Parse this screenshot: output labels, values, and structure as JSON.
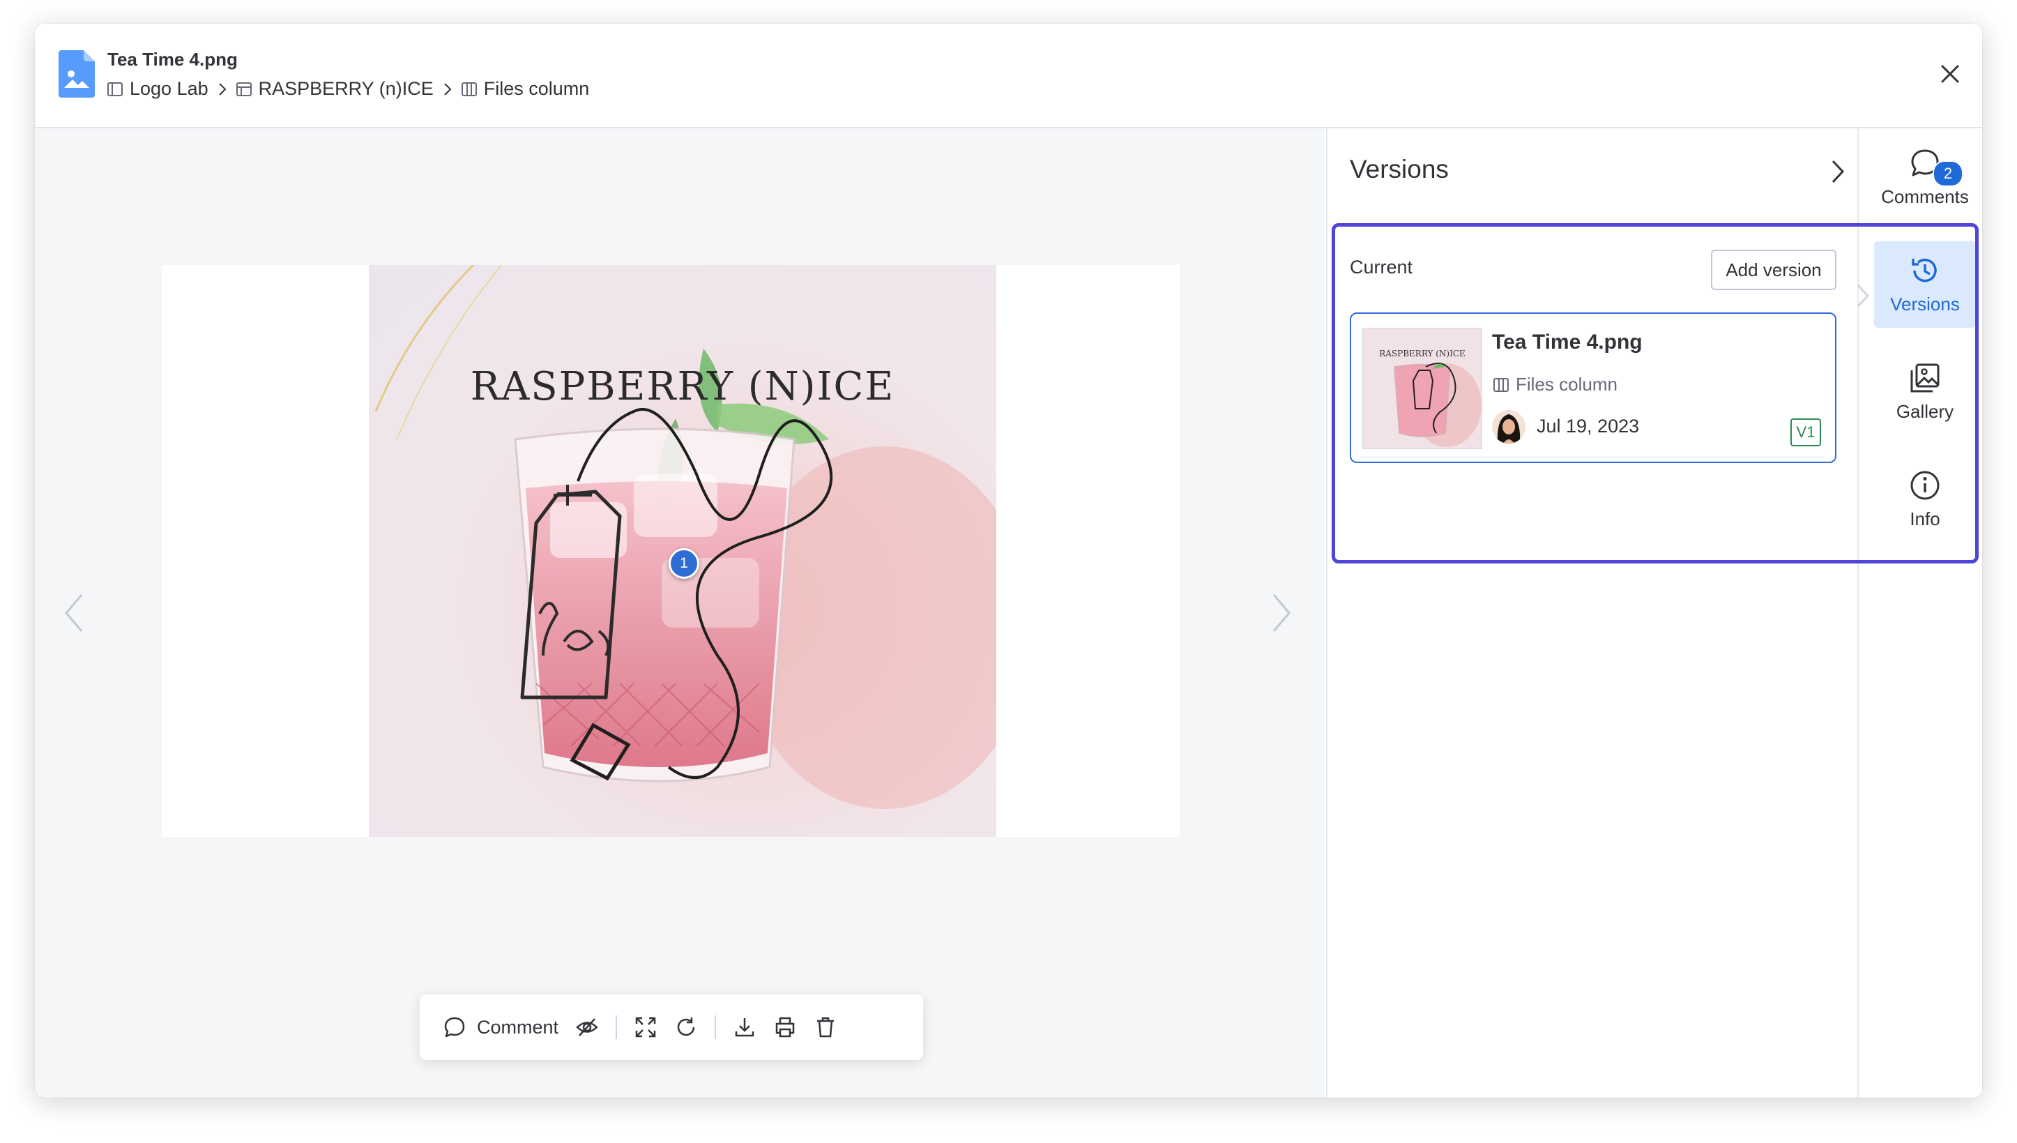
{
  "header": {
    "file_title": "Tea Time 4.png",
    "breadcrumb": [
      "Logo Lab",
      "RASPBERRY (n)ICE",
      "Files column"
    ]
  },
  "preview": {
    "image_title_text": "RASPBERRY (N)ICE",
    "pin_number": "1"
  },
  "toolbar": {
    "comment_label": "Comment"
  },
  "versions": {
    "title": "Versions",
    "current_label": "Current",
    "add_version_label": "Add version",
    "card": {
      "name": "Tea Time 4.png",
      "column": "Files column",
      "date": "Jul 19, 2023",
      "badge": "V1"
    }
  },
  "rail": {
    "comments_label": "Comments",
    "comments_count": "2",
    "versions_label": "Versions",
    "gallery_label": "Gallery",
    "info_label": "Info"
  },
  "colors": {
    "accent": "#1f6ad6",
    "highlight": "#4f46d9",
    "badge_green": "#2d8a4e"
  }
}
